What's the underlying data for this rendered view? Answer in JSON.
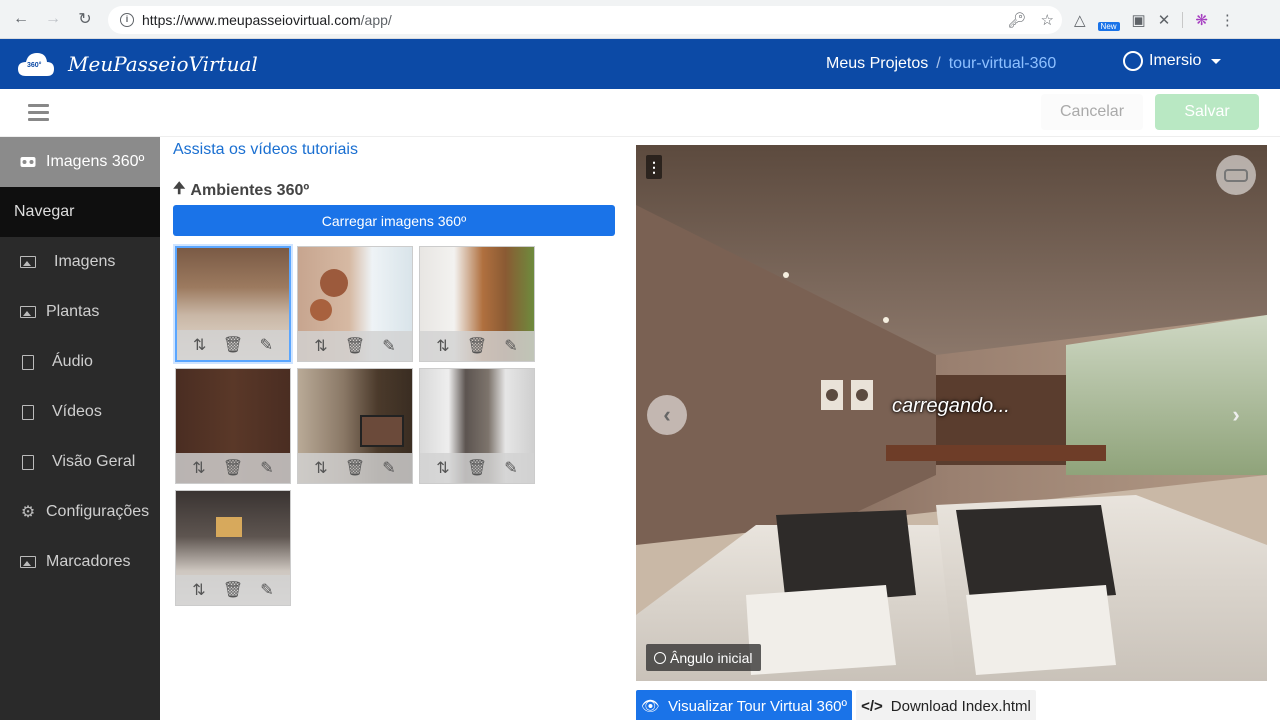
{
  "browser": {
    "url_host": "https://www.meupasseiovirtual.com",
    "url_path": "/app/",
    "ext_badge": "New"
  },
  "app": {
    "brand": "MeuPasseioVirtual",
    "logo_badge": "360°",
    "breadcrumb": [
      "Meus Projetos",
      "tour-virtual-360"
    ],
    "breadcrumb_sep": "/",
    "user": "Imersio"
  },
  "toolbar": {
    "cancel": "Cancelar",
    "save": "Salvar"
  },
  "sidebar": {
    "items": [
      {
        "label": "Imagens 360º",
        "icon": "vr-goggles-icon"
      },
      {
        "label": "Navegar",
        "icon": ""
      },
      {
        "label": "Imagens",
        "icon": "image-icon"
      },
      {
        "label": "Plantas",
        "icon": "image-icon"
      },
      {
        "label": "Áudio",
        "icon": "file-icon"
      },
      {
        "label": "Vídeos",
        "icon": "file-icon"
      },
      {
        "label": "Visão Geral",
        "icon": "file-icon"
      },
      {
        "label": "Configurações",
        "icon": "gear-icon"
      },
      {
        "label": "Marcadores",
        "icon": "image-icon"
      }
    ]
  },
  "main": {
    "tutorial_link": "Assista os vídeos tutoriais",
    "section_title": "Ambientes 360º",
    "upload_button": "Carregar imagens 360º"
  },
  "viewer": {
    "loading": "carregando...",
    "angle_button": "Ângulo inicial",
    "view_button": "Visualizar Tour Virtual 360º",
    "download_button": "Download Index.html"
  }
}
